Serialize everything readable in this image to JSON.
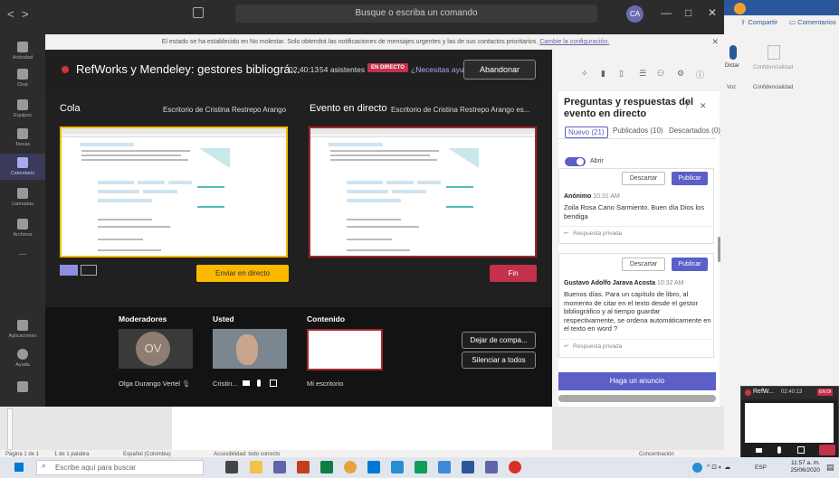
{
  "topbar": {
    "back": "<",
    "forward": ">",
    "compose_icon": "compose-icon",
    "search_placeholder": "Busque o escriba un comando",
    "avatar_initials": "CA",
    "minimize": "—",
    "maximize": "□",
    "close": "✕"
  },
  "rail": [
    {
      "label": "Actividad",
      "icon": "bell-icon"
    },
    {
      "label": "Chat",
      "icon": "chat-icon"
    },
    {
      "label": "Equipos",
      "icon": "teams-icon"
    },
    {
      "label": "Tareas",
      "icon": "tasks-icon"
    },
    {
      "label": "Calendario",
      "icon": "calendar-icon",
      "active": true
    },
    {
      "label": "Llamadas",
      "icon": "phone-icon"
    },
    {
      "label": "Archivos",
      "icon": "files-icon"
    },
    {
      "label": "...",
      "icon": "more-icon"
    },
    {
      "label": "Aplicaciones",
      "icon": "apps-icon"
    },
    {
      "label": "Ayuda",
      "icon": "help-icon"
    },
    {
      "label": "",
      "icon": "device-icon"
    }
  ],
  "notification": {
    "text": "El estado se ha establecido en No molestar. Solo obtendrá las notificaciones de mensajes urgentes y las de sus contactos prioritarios.",
    "link": "Cambie la configuración."
  },
  "meeting": {
    "title": "RefWorks y Mendeley: gestores bibliográ...",
    "time": "02:40:13",
    "attendees": "54 asistentes",
    "live_badge": "EN DIRECTO",
    "help": "¿Necesitas ayuda?",
    "leave": "Abandonar",
    "queue_title": "Cola",
    "queue_source": "Escritorio de Cristina Restrepo Arango",
    "live_title": "Evento en directo",
    "live_source": "Escritorio de Cristina Restrepo Arango es...",
    "send_live": "Enviar en directo",
    "end": "Fin",
    "moderators_title": "Moderadores",
    "you_title": "Usted",
    "content_title": "Contenido",
    "moderator_initials": "OV",
    "moderator_name": "Olga Durango Vertel",
    "you_name": "Cristin...",
    "content_name": "Mi escritorio",
    "stop_sharing": "Dejar de compa...",
    "mute_all": "Silenciar a todos"
  },
  "qa": {
    "title": "Preguntas y respuestas del evento en directo",
    "tabs": [
      {
        "label": "Nuevo (21)",
        "active": true
      },
      {
        "label": "Publicados (10)"
      },
      {
        "label": "Descartados (0)"
      }
    ],
    "toggle_label": "Abrir",
    "discard": "Descartar",
    "publish": "Publicar",
    "questions": [
      {
        "author": "Anónimo",
        "time": "10:31 AM",
        "text": "Zoila Rosa Cano Sarmiento. Buen día Dios los bendiga",
        "reply": "Respuesta privada"
      },
      {
        "author": "Gustavo Adolfo Jarava Acosta",
        "time": "10:32 AM",
        "text": "Buenos días. Para un capítulo de libro, al momento de citar en el texto desde el gestor bibliográfico y al tiempo guardar respectivamente, se ordena automáticamente en el texto en word ?",
        "reply": "Respuesta privada"
      }
    ],
    "announce": "Haga un anuncio"
  },
  "word": {
    "share": "Compartir",
    "comments": "Comentarios",
    "dictate": "Dictar",
    "confidentiality": "Confidencialidad",
    "voice_group": "Voz",
    "confidentiality_group": "Confidencialidad",
    "status_page": "Página 1 de 1",
    "status_words": "1 de 1 palabra",
    "status_lang": "Español (Colombia)",
    "status_access": "Accesibilidad: todo correcto",
    "status_focus": "Concentración"
  },
  "mini": {
    "title": "RefW...",
    "time": "02:40:13",
    "badge": "EN DI"
  },
  "taskbar": {
    "search": "Escribe aquí para buscar",
    "lang": "ESP",
    "time": "11:57 a. m.",
    "date": "25/06/2020"
  },
  "colors": {
    "accent": "#5b5fc7",
    "live_red": "#c4314b",
    "queue_yellow": "#fbb900"
  }
}
